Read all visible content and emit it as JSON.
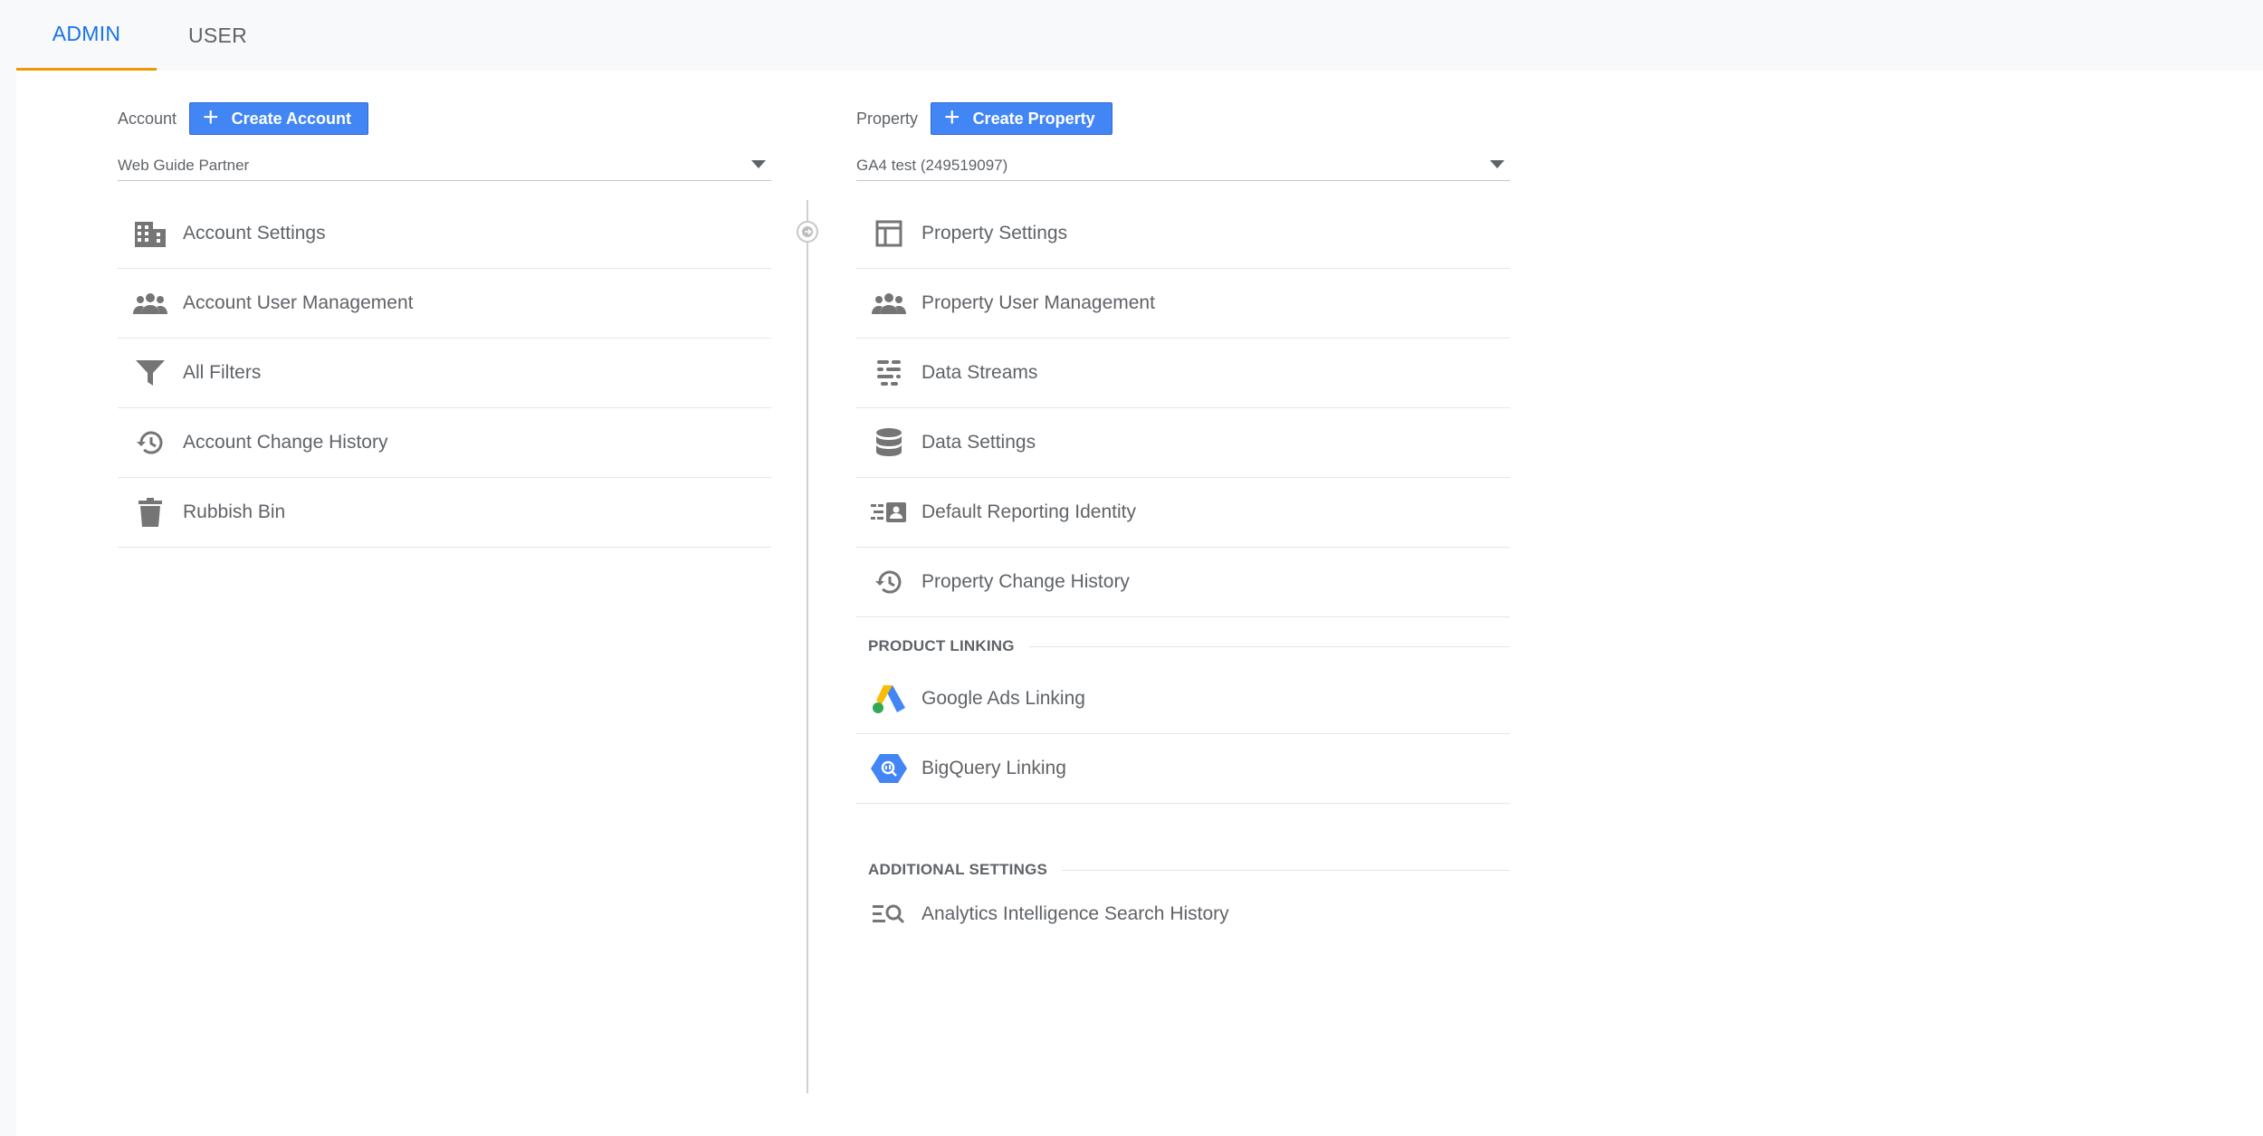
{
  "tabs": {
    "admin": "ADMIN",
    "user": "USER"
  },
  "account": {
    "label": "Account",
    "create_label": "Create Account",
    "selected": "Web Guide Partner",
    "items": [
      {
        "label": "Account Settings",
        "icon": "building-icon"
      },
      {
        "label": "Account User Management",
        "icon": "people-icon"
      },
      {
        "label": "All Filters",
        "icon": "filter-icon"
      },
      {
        "label": "Account Change History",
        "icon": "history-icon"
      },
      {
        "label": "Rubbish Bin",
        "icon": "trash-icon"
      }
    ]
  },
  "property": {
    "label": "Property",
    "create_label": "Create Property",
    "selected": "GA4 test (249519097)",
    "items": [
      {
        "label": "Property Settings",
        "icon": "layout-icon"
      },
      {
        "label": "Property User Management",
        "icon": "people-icon"
      },
      {
        "label": "Data Streams",
        "icon": "streams-icon"
      },
      {
        "label": "Data Settings",
        "icon": "database-icon"
      },
      {
        "label": "Default Reporting Identity",
        "icon": "identity-icon"
      },
      {
        "label": "Property Change History",
        "icon": "history-icon"
      }
    ],
    "product_linking": {
      "heading": "PRODUCT LINKING",
      "items": [
        {
          "label": "Google Ads Linking",
          "icon": "google-ads-icon"
        },
        {
          "label": "BigQuery Linking",
          "icon": "bigquery-icon"
        }
      ]
    },
    "additional_settings": {
      "heading": "ADDITIONAL SETTINGS",
      "items": [
        {
          "label": "Analytics Intelligence Search History",
          "icon": "search-history-icon"
        }
      ]
    }
  },
  "colors": {
    "accent_blue": "#1a73e8",
    "button_blue": "#4285f4",
    "tab_underline": "#f29900",
    "icon_grey": "#757575"
  }
}
